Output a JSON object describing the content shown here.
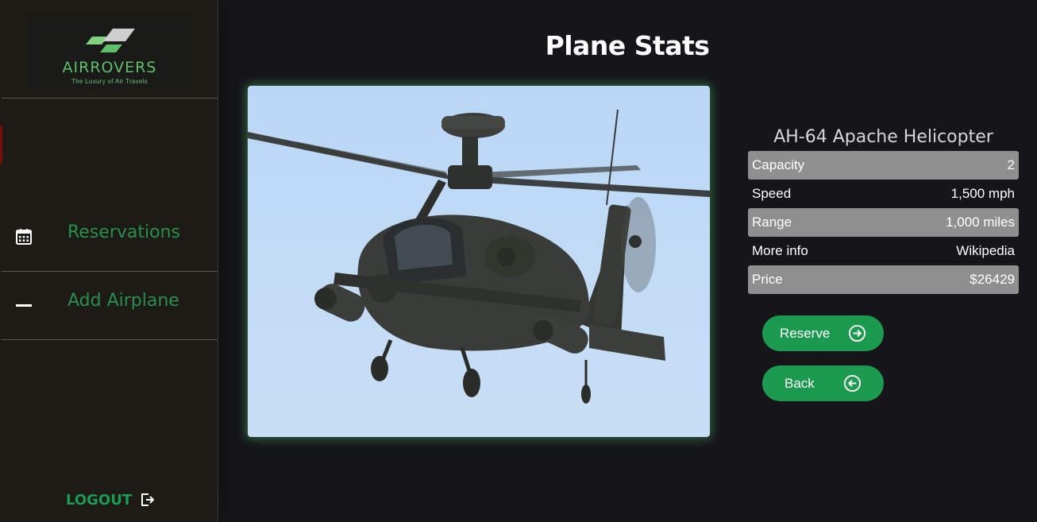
{
  "brand": {
    "name": "AIRROVERS",
    "tagline": "The Luxury of Air Travels",
    "colors": {
      "accent": "#1c9a50",
      "nav_text": "#2a8f4c",
      "logo_green": "#5fbf6a"
    }
  },
  "sidebar": {
    "items": [
      {
        "label": "Reservations",
        "icon": "calendar-icon"
      },
      {
        "label": "Add Airplane",
        "icon": "minus-icon"
      }
    ],
    "logout": {
      "label": "LOGOUT",
      "icon": "logout-icon"
    }
  },
  "page": {
    "title": "Plane Stats"
  },
  "plane": {
    "name": "AH-64 Apache Helicopter",
    "image": "helicopter-photo",
    "stats": [
      {
        "label": "Capacity",
        "value": "2"
      },
      {
        "label": "Speed",
        "value": "1,500 mph"
      },
      {
        "label": "Range",
        "value": "1,000 miles"
      },
      {
        "label": "More info",
        "value": "Wikipedia"
      },
      {
        "label": "Price",
        "value": "$26429"
      }
    ]
  },
  "actions": {
    "reserve": {
      "label": "Reserve",
      "icon": "arrow-right-circle-icon"
    },
    "back": {
      "label": "Back",
      "icon": "arrow-left-circle-icon"
    }
  }
}
